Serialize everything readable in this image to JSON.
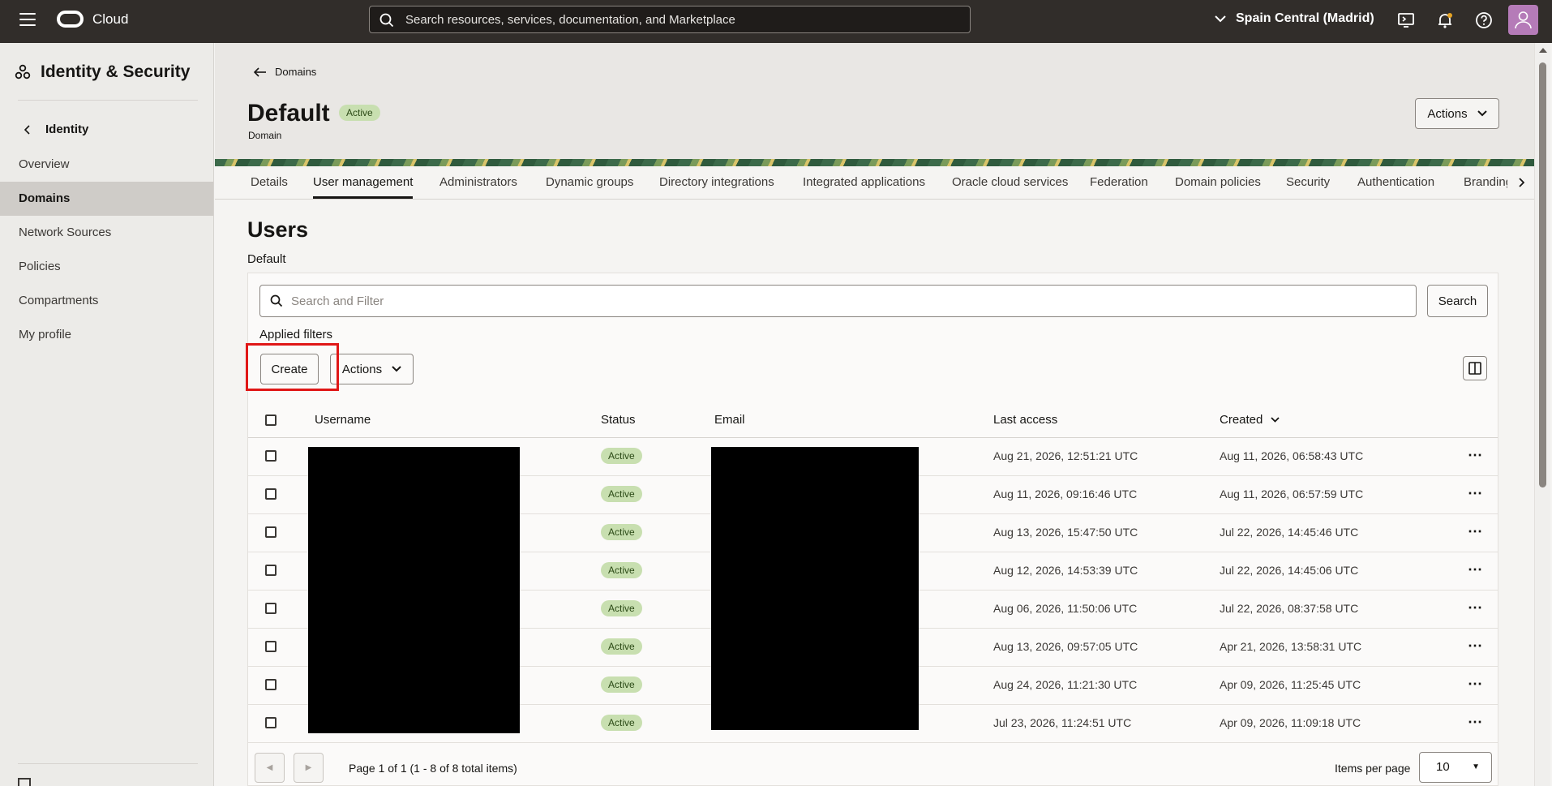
{
  "topbar": {
    "brand": "Cloud",
    "search_placeholder": "Search resources, services, documentation, and Marketplace",
    "region": "Spain Central (Madrid)"
  },
  "sidebar": {
    "title": "Identity & Security",
    "back_label": "Identity",
    "items": [
      {
        "label": "Overview",
        "active": false
      },
      {
        "label": "Domains",
        "active": true
      },
      {
        "label": "Network Sources",
        "active": false
      },
      {
        "label": "Policies",
        "active": false
      },
      {
        "label": "Compartments",
        "active": false
      },
      {
        "label": "My profile",
        "active": false
      }
    ]
  },
  "header": {
    "back_label": "Domains",
    "title": "Default",
    "status": "Active",
    "subtitle": "Domain",
    "actions_label": "Actions"
  },
  "tabs": [
    {
      "label": "Details"
    },
    {
      "label": "User management",
      "active": true
    },
    {
      "label": "Administrators"
    },
    {
      "label": "Dynamic groups"
    },
    {
      "label": "Directory integrations"
    },
    {
      "label": "Integrated applications"
    },
    {
      "label": "Oracle cloud services"
    },
    {
      "label": "Federation"
    },
    {
      "label": "Domain policies"
    },
    {
      "label": "Security"
    },
    {
      "label": "Authentication"
    },
    {
      "label": "Branding"
    }
  ],
  "users": {
    "title": "Users",
    "subtitle": "Default",
    "filter_placeholder": "Search and Filter",
    "search_label": "Search",
    "applied_filters": "Applied filters",
    "create_label": "Create",
    "actions_label": "Actions"
  },
  "table": {
    "columns": {
      "username": "Username",
      "status": "Status",
      "email": "Email",
      "last_access": "Last access",
      "created": "Created"
    },
    "rows": [
      {
        "status": "Active",
        "last_access": "Aug 21, 2026, 12:51:21 UTC",
        "created": "Aug 11, 2026, 06:58:43 UTC"
      },
      {
        "status": "Active",
        "last_access": "Aug 11, 2026, 09:16:46 UTC",
        "created": "Aug 11, 2026, 06:57:59 UTC"
      },
      {
        "status": "Active",
        "last_access": "Aug 13, 2026, 15:47:50 UTC",
        "created": "Jul 22, 2026, 14:45:46 UTC"
      },
      {
        "status": "Active",
        "last_access": "Aug 12, 2026, 14:53:39 UTC",
        "created": "Jul 22, 2026, 14:45:06 UTC"
      },
      {
        "status": "Active",
        "last_access": "Aug 06, 2026, 11:50:06 UTC",
        "created": "Jul 22, 2026, 08:37:58 UTC"
      },
      {
        "status": "Active",
        "last_access": "Aug 13, 2026, 09:57:05 UTC",
        "created": "Apr 21, 2026, 13:58:31 UTC"
      },
      {
        "status": "Active",
        "last_access": "Aug 24, 2026, 11:21:30 UTC",
        "created": "Apr 09, 2026, 11:25:45 UTC"
      },
      {
        "status": "Active",
        "last_access": "Jul 23, 2026, 11:24:51 UTC",
        "created": "Apr 09, 2026, 11:09:18 UTC"
      }
    ]
  },
  "pagination": {
    "text": "Page 1 of 1 (1 - 8 of 8 total items)",
    "items_per_page_label": "Items per page",
    "items_per_page": "10"
  },
  "colors": {
    "topbar": "#312d2a",
    "active_badge_bg": "#c8dfb0",
    "highlight": "#e01717"
  }
}
